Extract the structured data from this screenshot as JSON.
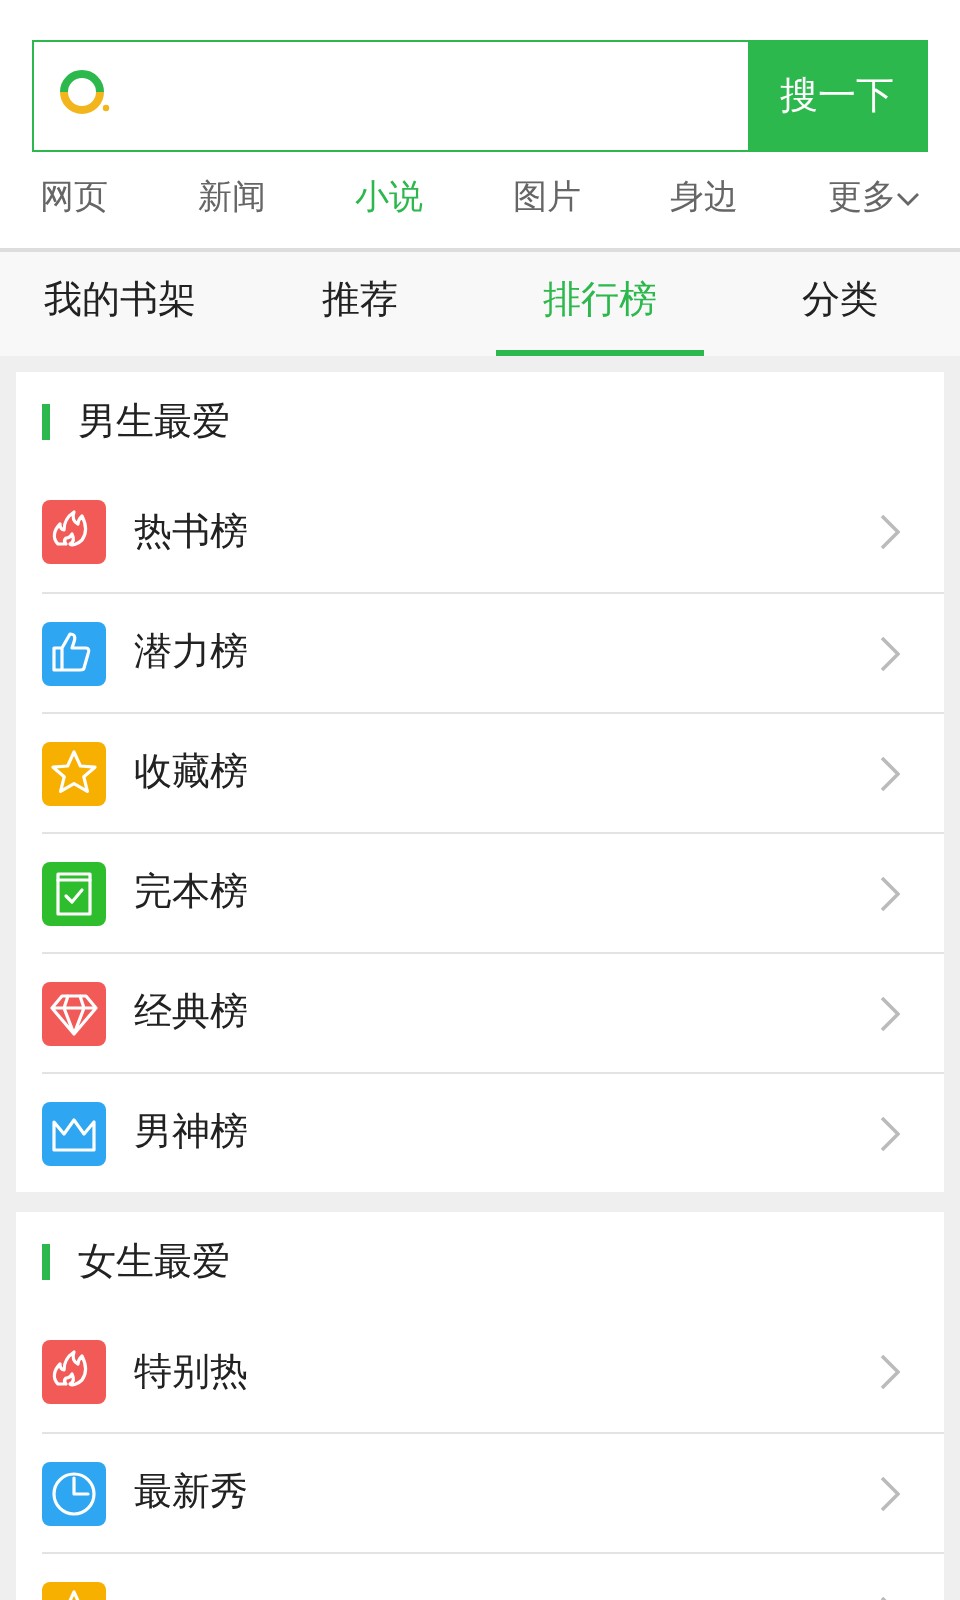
{
  "search": {
    "button": "搜一下"
  },
  "nav": [
    {
      "label": "网页",
      "selected": false
    },
    {
      "label": "新闻",
      "selected": false
    },
    {
      "label": "小说",
      "selected": true
    },
    {
      "label": "图片",
      "selected": false
    },
    {
      "label": "身边",
      "selected": false
    },
    {
      "label": "更多",
      "selected": false,
      "dropdown": true
    }
  ],
  "tabs": [
    {
      "label": "我的书架",
      "selected": false
    },
    {
      "label": "推荐",
      "selected": false
    },
    {
      "label": "排行榜",
      "selected": true
    },
    {
      "label": "分类",
      "selected": false
    }
  ],
  "sections": [
    {
      "title": "男生最爱",
      "items": [
        {
          "label": "热书榜",
          "kind": "fire",
          "color": "#f25a57"
        },
        {
          "label": "潜力榜",
          "kind": "thumb",
          "color": "#2ea6f2"
        },
        {
          "label": "收藏榜",
          "kind": "star",
          "color": "#f7b000"
        },
        {
          "label": "完本榜",
          "kind": "check",
          "color": "#2dbd2d"
        },
        {
          "label": "经典榜",
          "kind": "diamond",
          "color": "#f25a57"
        },
        {
          "label": "男神榜",
          "kind": "crown",
          "color": "#2ea6f2"
        }
      ]
    },
    {
      "title": "女生最爱",
      "items": [
        {
          "label": "特别热",
          "kind": "fire",
          "color": "#f25a57"
        },
        {
          "label": "最新秀",
          "kind": "clock",
          "color": "#2ea6f2"
        },
        {
          "kind": "star",
          "color": "#f7b000"
        }
      ]
    }
  ]
}
